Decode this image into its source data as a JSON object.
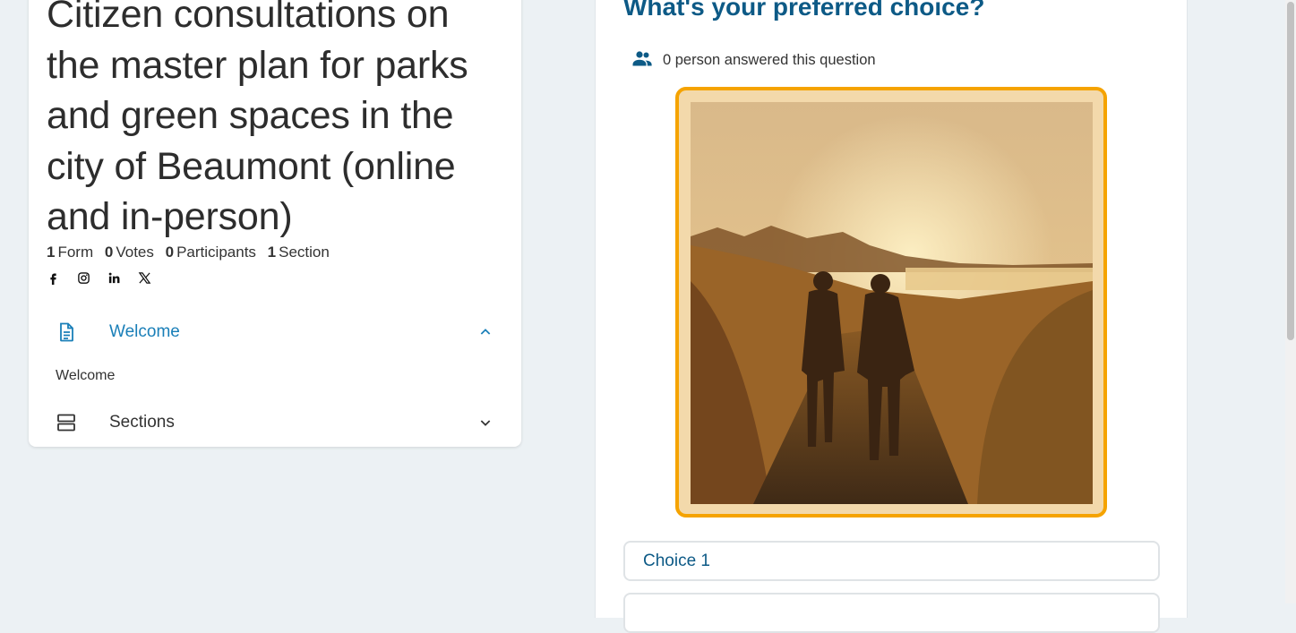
{
  "project": {
    "title": "Citizen consultations on the master plan for parks and green spaces in the city of Beaumont (online and in-person)",
    "stats": [
      {
        "count": "1",
        "label": "Form"
      },
      {
        "count": "0",
        "label": "Votes"
      },
      {
        "count": "0",
        "label": "Participants"
      },
      {
        "count": "1",
        "label": "Section"
      }
    ],
    "socials": [
      "facebook-icon",
      "instagram-icon",
      "linkedin-icon",
      "x-icon"
    ]
  },
  "nav": {
    "welcome_label": "Welcome",
    "welcome_sub": "Welcome",
    "sections_label": "Sections"
  },
  "question": {
    "title": "What's your preferred choice?",
    "answered_text": "0 person answered this question",
    "choices": [
      "Choice 1",
      ""
    ]
  },
  "colors": {
    "accent": "#1a7fb8",
    "question_blue": "#0d5a86",
    "selected_border": "#f5a300"
  }
}
